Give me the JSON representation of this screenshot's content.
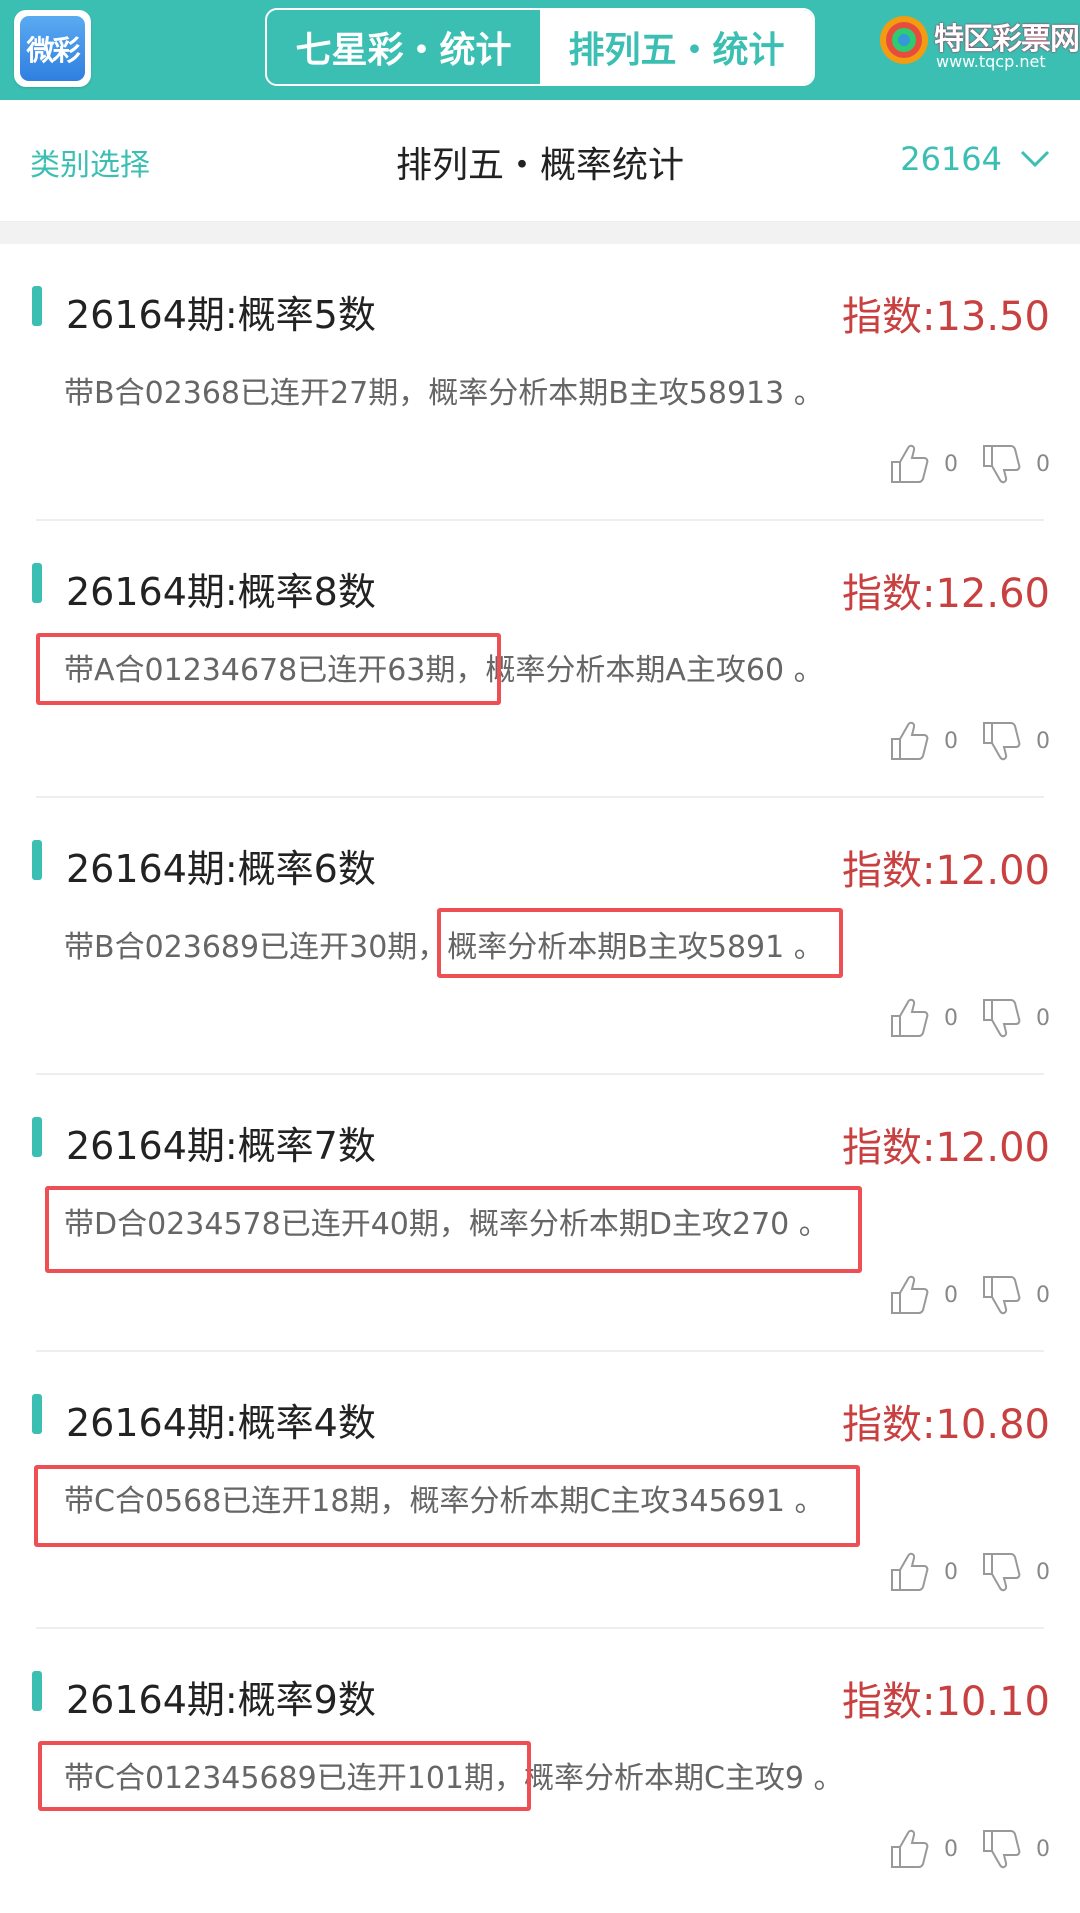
{
  "header": {
    "logo_text": "微彩",
    "tabs": [
      {
        "label": "七星彩・统计",
        "active": false
      },
      {
        "label": "排列五・统计",
        "active": true
      }
    ],
    "brand_name": "特区彩票网",
    "brand_url": "www.tqcp.net"
  },
  "subheader": {
    "category_label": "类别选择",
    "title": "排列五・概率统计",
    "issue": "26164"
  },
  "colors": {
    "accent": "#3bbfb3",
    "index_red": "#c94040",
    "highlight": "#ee4f55"
  },
  "items": [
    {
      "title": "26164期:概率5数",
      "index": "指数:13.50",
      "desc": "带B合02368已连开27期，概率分析本期B主攻58913 。",
      "likes": "0",
      "dislikes": "0",
      "highlight": "none"
    },
    {
      "title": "26164期:概率8数",
      "index": "指数:12.60",
      "desc": "带A合01234678已连开63期，概率分析本期A主攻60 。",
      "likes": "0",
      "dislikes": "0",
      "highlight": "first-clause"
    },
    {
      "title": "26164期:概率6数",
      "index": "指数:12.00",
      "desc": "带B合023689已连开30期，概率分析本期B主攻5891 。",
      "likes": "0",
      "dislikes": "0",
      "highlight": "second-clause"
    },
    {
      "title": "26164期:概率7数",
      "index": "指数:12.00",
      "desc": "带D合0234578已连开40期，概率分析本期D主攻270 。",
      "likes": "0",
      "dislikes": "0",
      "highlight": "full"
    },
    {
      "title": "26164期:概率4数",
      "index": "指数:10.80",
      "desc": "带C合0568已连开18期，概率分析本期C主攻345691 。",
      "likes": "0",
      "dislikes": "0",
      "highlight": "full"
    },
    {
      "title": "26164期:概率9数",
      "index": "指数:10.10",
      "desc": "带C合012345689已连开101期，概率分析本期C主攻9 。",
      "likes": "0",
      "dislikes": "0",
      "highlight": "first-clause"
    }
  ]
}
